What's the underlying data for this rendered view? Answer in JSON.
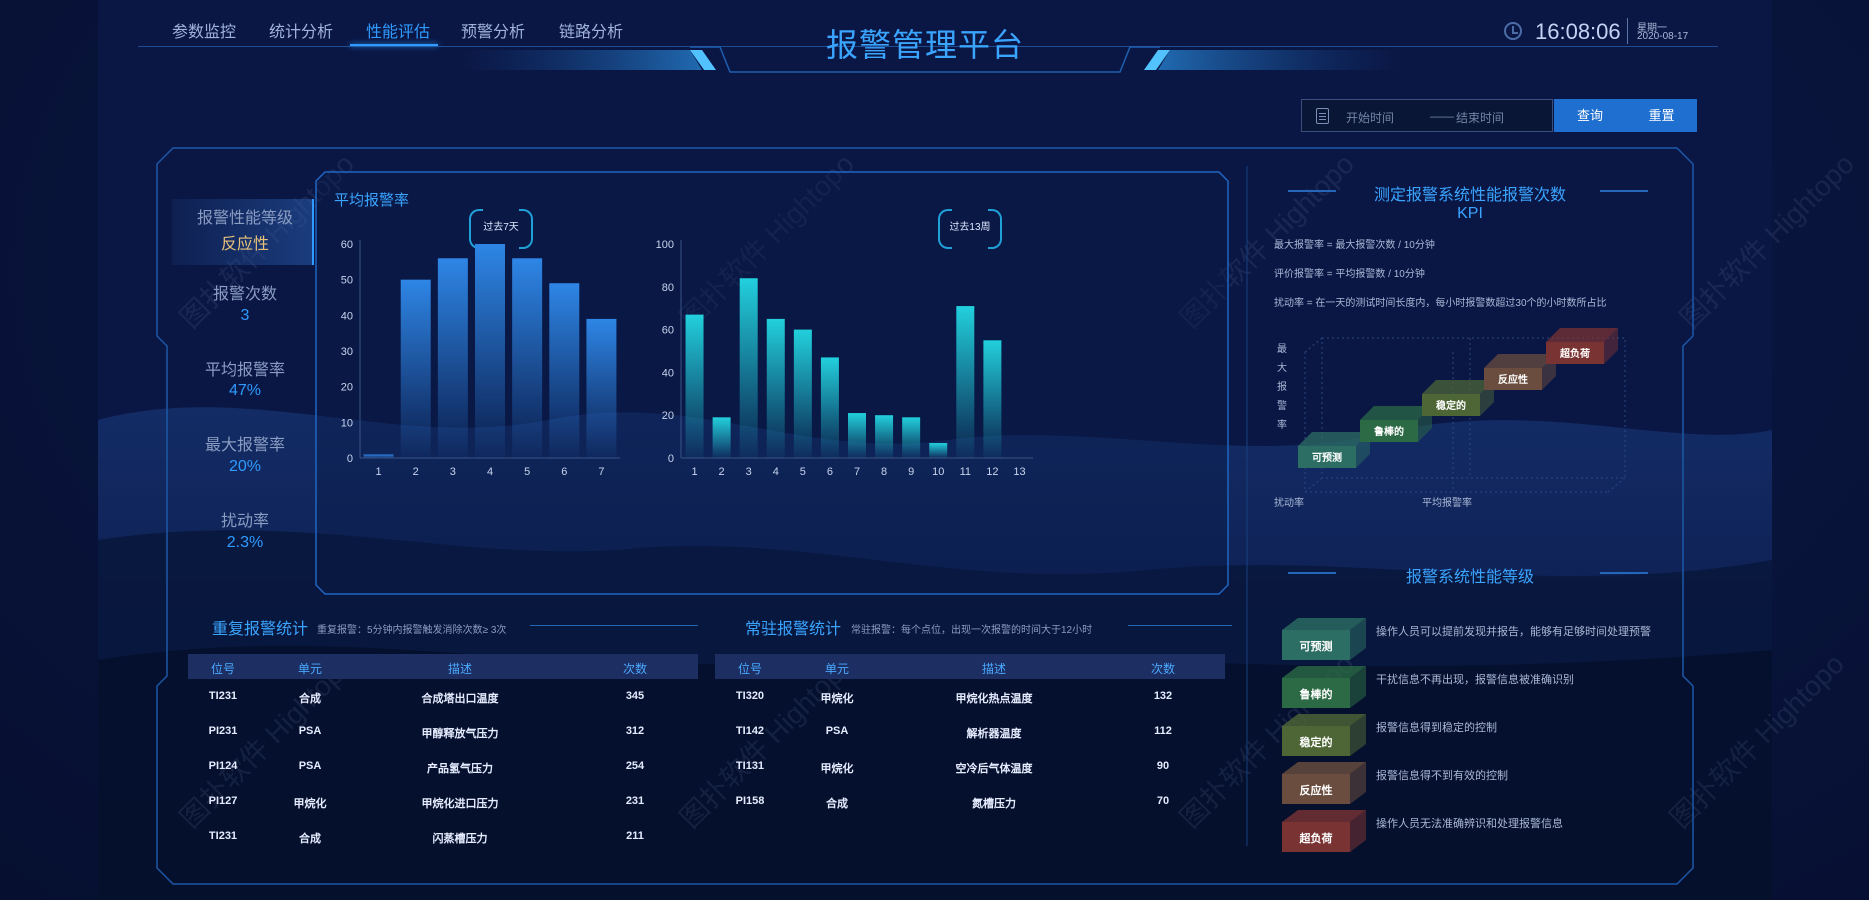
{
  "header": {
    "nav": [
      {
        "label": "参数监控",
        "active": false
      },
      {
        "label": "统计分析",
        "active": false
      },
      {
        "label": "性能评估",
        "active": true
      },
      {
        "label": "预警分析",
        "active": false
      },
      {
        "label": "链路分析",
        "active": false
      }
    ],
    "title": "报警管理平台",
    "time": "16:08:06",
    "weekday": "星期一",
    "date": "2020-08-17"
  },
  "filter": {
    "start_placeholder": "开始时间",
    "separator": "——",
    "end_placeholder": "结束时间",
    "query_label": "查询",
    "reset_label": "重置"
  },
  "sidebar": {
    "items": [
      {
        "label": "报警性能等级",
        "value": "反应性"
      },
      {
        "label": "报警次数",
        "value": "3"
      },
      {
        "label": "平均报警率",
        "value": "47%"
      },
      {
        "label": "最大报警率",
        "value": "20%"
      },
      {
        "label": "扰动率",
        "value": "2.3%"
      }
    ]
  },
  "chart_panel": {
    "title": "平均报警率",
    "badge_left": "过去7天",
    "badge_right": "过去13周"
  },
  "chart_data": [
    {
      "type": "bar",
      "title": "过去7天",
      "categories": [
        "1",
        "2",
        "3",
        "4",
        "5",
        "6",
        "7"
      ],
      "values": [
        1,
        50,
        56,
        60,
        56,
        49,
        39
      ],
      "ylim": [
        0,
        60
      ],
      "yticks": [
        0,
        10,
        20,
        30,
        40,
        50,
        60
      ],
      "color": "#2e86e6"
    },
    {
      "type": "bar",
      "title": "过去13周",
      "categories": [
        "1",
        "2",
        "3",
        "4",
        "5",
        "6",
        "7",
        "8",
        "9",
        "10",
        "11",
        "12",
        "13"
      ],
      "values": [
        67,
        19,
        84,
        65,
        60,
        47,
        21,
        20,
        19,
        7,
        71,
        55,
        0
      ],
      "ylim": [
        0,
        100
      ],
      "yticks": [
        0,
        20,
        40,
        60,
        80,
        100
      ],
      "color": "#22d0dd"
    }
  ],
  "repeat_table": {
    "title": "重复报警统计",
    "subtitle": "重复报警：5分钟内报警触发消除次数≥ 3次",
    "headers": [
      "位号",
      "单元",
      "描述",
      "次数"
    ],
    "rows": [
      [
        "TI231",
        "合成",
        "合成塔出口温度",
        "345"
      ],
      [
        "PI231",
        "PSA",
        "甲醇释放气压力",
        "312"
      ],
      [
        "PI124",
        "PSA",
        "产品氢气压力",
        "254"
      ],
      [
        "PI127",
        "甲烷化",
        "甲烷化进口压力",
        "231"
      ],
      [
        "TI231",
        "合成",
        "闪蒸槽压力",
        "211"
      ]
    ]
  },
  "standing_table": {
    "title": "常驻报警统计",
    "subtitle": "常驻报警：每个点位，出现一次报警的时间大于12小时",
    "headers": [
      "位号",
      "单元",
      "描述",
      "次数"
    ],
    "rows": [
      [
        "TI320",
        "甲烷化",
        "甲烷化热点温度",
        "132"
      ],
      [
        "TI142",
        "PSA",
        "解析器温度",
        "112"
      ],
      [
        "TI131",
        "甲烷化",
        "空冷后气体温度",
        "90"
      ],
      [
        "PI158",
        "合成",
        "氮槽压力",
        "70"
      ]
    ]
  },
  "kpi": {
    "title": "测定报警系统性能报警次数KPI",
    "definitions": [
      "最大报警率 = 最大报警次数 / 10分钟",
      "评价报警率 = 平均报警数 / 10分钟",
      "扰动率 = 在一天的测试时间长度内，每小时报警数超过30个的小时数所占比"
    ],
    "y_axis_label": "最大报警率",
    "x_label_left": "扰动率",
    "x_label_right": "平均报警率",
    "steps": [
      "可预测",
      "鲁棒的",
      "稳定的",
      "反应性",
      "超负荷"
    ]
  },
  "levels": {
    "title": "报警系统性能等级",
    "items": [
      {
        "name": "可预测",
        "desc": "操作人员可以提前发现并报告，能够有足够时间处理预警",
        "color": "#2c6e63"
      },
      {
        "name": "鲁棒的",
        "desc": "干扰信息不再出现，报警信息被准确识别",
        "color": "#2b6a45"
      },
      {
        "name": "稳定的",
        "desc": "报警信息得到稳定的控制",
        "color": "#4e6636"
      },
      {
        "name": "反应性",
        "desc": "报警信息得不到有效的控制",
        "color": "#6a4d3e"
      },
      {
        "name": "超负荷",
        "desc": "操作人员无法准确辨识和处理报警信息",
        "color": "#7a3333"
      }
    ]
  },
  "watermark": {
    "line1": "图扑软件",
    "line2": "Hightopo"
  }
}
